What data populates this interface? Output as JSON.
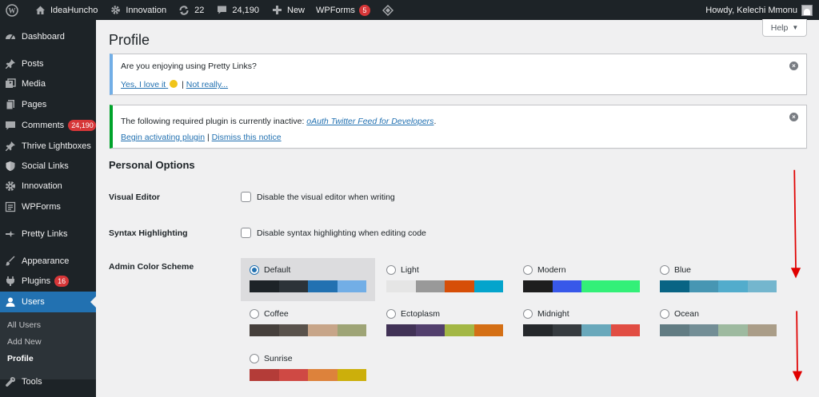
{
  "adminbar": {
    "site_name": "IdeaHuncho",
    "innovation": "Innovation",
    "updates": "22",
    "comments": "24,190",
    "new": "New",
    "wpforms": "WPForms",
    "wpforms_badge": "5",
    "greeting": "Howdy, Kelechi Mmonu"
  },
  "sidebar": {
    "items": [
      {
        "label": "Dashboard",
        "icon": "dashboard-icon"
      },
      {
        "label": "Posts",
        "icon": "pin-icon"
      },
      {
        "label": "Media",
        "icon": "media-icon"
      },
      {
        "label": "Pages",
        "icon": "pages-icon"
      },
      {
        "label": "Comments",
        "icon": "comment-icon",
        "badge": "24,190"
      },
      {
        "label": "Thrive Lightboxes",
        "icon": "pin-icon"
      },
      {
        "label": "Social Links",
        "icon": "shield-icon"
      },
      {
        "label": "Innovation",
        "icon": "gear-icon"
      },
      {
        "label": "WPForms",
        "icon": "forms-icon"
      },
      {
        "label": "Pretty Links",
        "icon": "star-icon"
      },
      {
        "label": "Appearance",
        "icon": "brush-icon"
      },
      {
        "label": "Plugins",
        "icon": "plug-icon",
        "badge": "16"
      },
      {
        "label": "Users",
        "icon": "user-icon"
      },
      {
        "label": "Tools",
        "icon": "wrench-icon"
      }
    ],
    "submenu": [
      "All Users",
      "Add New",
      "Profile"
    ]
  },
  "page": {
    "title": "Profile",
    "help": "Help"
  },
  "notice1": {
    "question": "Are you enjoying using Pretty Links?",
    "yes": "Yes, I love it",
    "separator": "|",
    "no": "Not really..."
  },
  "notice2": {
    "text": "The following required plugin is currently inactive:",
    "plugin": "oAuth Twitter Feed for Developers",
    "period": ".",
    "activate": "Begin activating plugin",
    "separator": "|",
    "dismiss": "Dismiss this notice"
  },
  "personal": {
    "title": "Personal Options",
    "visual_editor_label": "Visual Editor",
    "visual_editor_text": "Disable the visual editor when writing",
    "syntax_label": "Syntax Highlighting",
    "syntax_text": "Disable syntax highlighting when editing code",
    "color_scheme_label": "Admin Color Scheme"
  },
  "schemes": [
    {
      "name": "Default",
      "colors": [
        "#1d2327",
        "#2c3338",
        "#2271b1",
        "#72aee6"
      ],
      "selected": true
    },
    {
      "name": "Light",
      "colors": [
        "#e5e5e5",
        "#999999",
        "#d64e07",
        "#04a4cc"
      ],
      "selected": false
    },
    {
      "name": "Modern",
      "colors": [
        "#1e1e1e",
        "#3858e9",
        "#33f078",
        "#33f078"
      ],
      "selected": false
    },
    {
      "name": "Blue",
      "colors": [
        "#096484",
        "#4796b3",
        "#52accc",
        "#74b6ce"
      ],
      "selected": false
    },
    {
      "name": "Coffee",
      "colors": [
        "#46403c",
        "#59524c",
        "#c7a589",
        "#9ea476"
      ],
      "selected": false
    },
    {
      "name": "Ectoplasm",
      "colors": [
        "#413256",
        "#523f6d",
        "#a3b745",
        "#d46f15"
      ],
      "selected": false
    },
    {
      "name": "Midnight",
      "colors": [
        "#25282b",
        "#363b3f",
        "#69a8bb",
        "#e14d43"
      ],
      "selected": false
    },
    {
      "name": "Ocean",
      "colors": [
        "#627c83",
        "#738e96",
        "#9ebaa0",
        "#aa9d88"
      ],
      "selected": false
    },
    {
      "name": "Sunrise",
      "colors": [
        "#b43c38",
        "#cf4944",
        "#dd823b",
        "#ccaf0b"
      ],
      "selected": false
    }
  ],
  "colors": {
    "adminbar_bg": "#1d2327",
    "accent": "#2271b1",
    "badge": "#d63638",
    "annotation_arrow": "#e00000"
  }
}
